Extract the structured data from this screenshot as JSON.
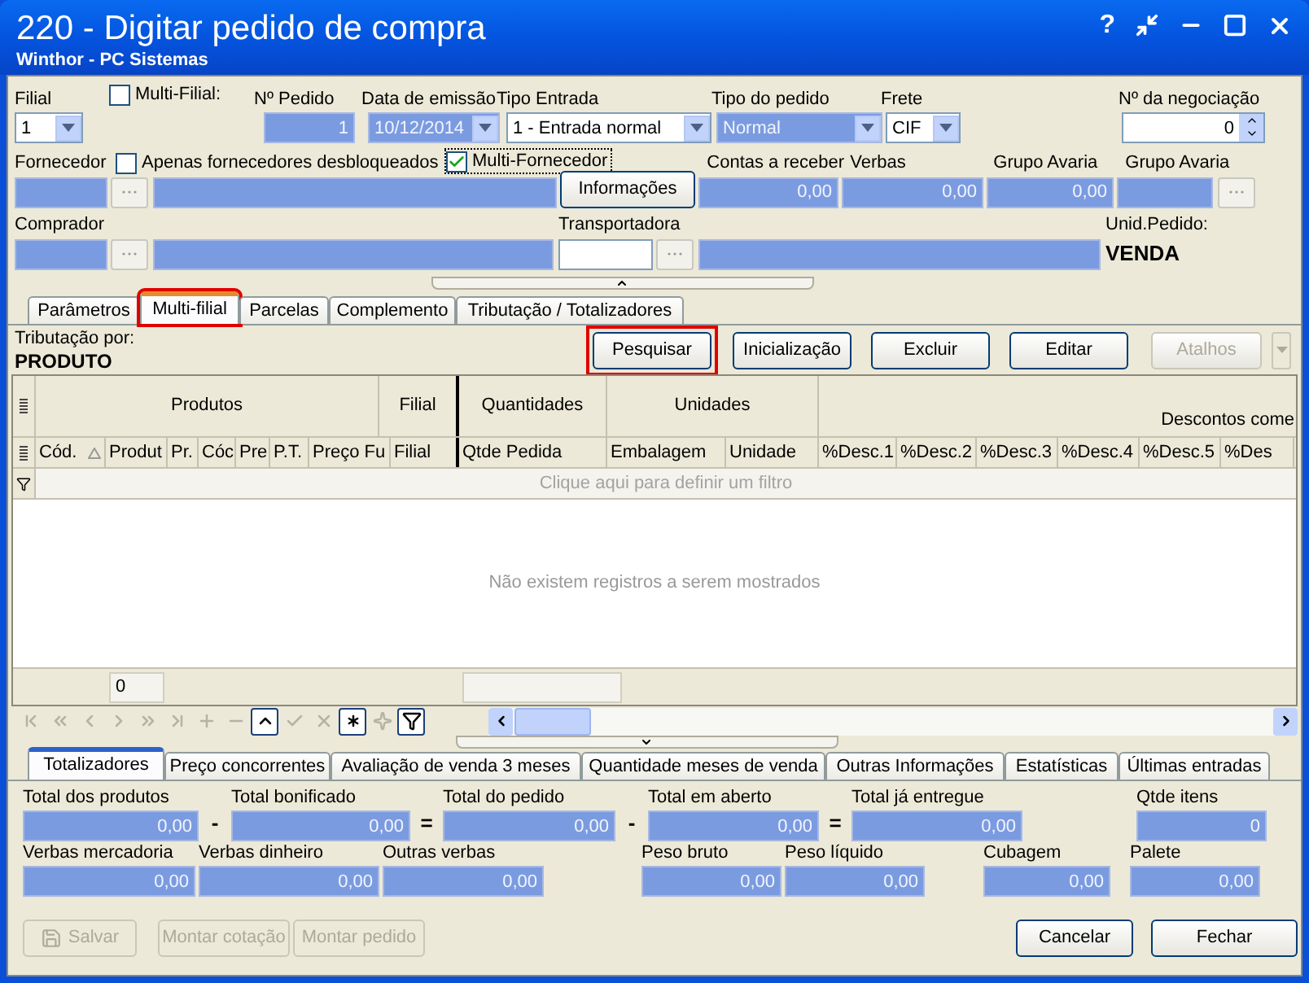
{
  "window": {
    "title": "220 - Digitar pedido de compra",
    "subtitle": "Winthor - PC Sistemas",
    "help_glyph": "?"
  },
  "header": {
    "filial": {
      "label": "Filial",
      "value": "1",
      "readonly": false
    },
    "multi_filial": {
      "label": "Multi-Filial:",
      "checked": false
    },
    "numero_pedido": {
      "label": "Nº Pedido",
      "value": "1",
      "readonly": true
    },
    "data_emissao": {
      "label": "Data de emissão",
      "value": "10/12/2014",
      "readonly": true
    },
    "tipo_entrada": {
      "label": "Tipo Entrada",
      "value": "1 - Entrada normal",
      "readonly": false
    },
    "tipo_pedido": {
      "label": "Tipo do pedido",
      "value": "Normal",
      "readonly": true
    },
    "frete": {
      "label": "Frete",
      "value": "CIF",
      "readonly": false
    },
    "negociacao": {
      "label": "Nº da negociação",
      "value": "0",
      "readonly": false
    },
    "fornecedor": {
      "label": "Fornecedor"
    },
    "apenas_desbloqueados": {
      "label": "Apenas fornecedores desbloqueados",
      "checked": false
    },
    "multi_fornecedor": {
      "label": "Multi-Fornecedor",
      "checked": true
    },
    "informacoes_button": "Informações",
    "contas_receber": {
      "label": "Contas a receber",
      "value": "0,00"
    },
    "verbas": {
      "label": "Verbas",
      "value": "0,00"
    },
    "grupo_avaria": {
      "label": "Grupo Avaria",
      "value": "0,00"
    },
    "grupo_avaria_2": {
      "label": "Grupo Avaria"
    },
    "comprador": {
      "label": "Comprador"
    },
    "transportadora": {
      "label": "Transportadora"
    },
    "unid_pedido": {
      "label": "Unid.Pedido:",
      "value": "VENDA"
    }
  },
  "tabs": [
    {
      "label": "Parâmetros",
      "selected": false,
      "highlighted": false
    },
    {
      "label": "Multi-filial",
      "selected": true,
      "highlighted": true
    },
    {
      "label": "Parcelas",
      "selected": false,
      "highlighted": false
    },
    {
      "label": "Complemento",
      "selected": false,
      "highlighted": false
    },
    {
      "label": "Tributação / Totalizadores",
      "selected": false,
      "highlighted": false
    }
  ],
  "tributacao": {
    "label": "Tributação por:",
    "value": "PRODUTO"
  },
  "actions": [
    {
      "label": "Pesquisar",
      "highlighted": true,
      "disabled": false
    },
    {
      "label": "Inicialização",
      "highlighted": false,
      "disabled": false
    },
    {
      "label": "Excluir",
      "highlighted": false,
      "disabled": false
    },
    {
      "label": "Editar",
      "highlighted": false,
      "disabled": false
    },
    {
      "label": "Atalhos",
      "highlighted": false,
      "disabled": true
    }
  ],
  "grid": {
    "bands": [
      "Produtos",
      "Filial",
      "Quantidades",
      "Unidades",
      "Descontos come"
    ],
    "columns": [
      {
        "label": "Cód.",
        "sorted": true
      },
      {
        "label": "Produt",
        "sorted": false
      },
      {
        "label": "Pr.",
        "sorted": false
      },
      {
        "label": "Cóc",
        "sorted": false
      },
      {
        "label": "Pre",
        "sorted": false
      },
      {
        "label": "P.T.",
        "sorted": false
      },
      {
        "label": "Preço Fu",
        "sorted": false
      },
      {
        "label": "Filial",
        "sorted": false
      },
      {
        "label": "Qtde Pedida",
        "sorted": false
      },
      {
        "label": "Embalagem",
        "sorted": false
      },
      {
        "label": "Unidade",
        "sorted": false
      },
      {
        "label": "%Desc.1",
        "sorted": false
      },
      {
        "label": "%Desc.2",
        "sorted": false
      },
      {
        "label": "%Desc.3",
        "sorted": false
      },
      {
        "label": "%Desc.4",
        "sorted": false
      },
      {
        "label": "%Desc.5",
        "sorted": false
      },
      {
        "label": "%Des",
        "sorted": false
      }
    ],
    "filter_hint": "Clique aqui para definir um filtro",
    "empty_message": "Não existem registros a serem mostrados",
    "footer_count": "0"
  },
  "bottom_tabs": [
    {
      "label": "Totalizadores",
      "selected": true
    },
    {
      "label": "Preço concorrentes",
      "selected": false
    },
    {
      "label": "Avaliação de venda 3 meses",
      "selected": false
    },
    {
      "label": "Quantidade meses de venda",
      "selected": false
    },
    {
      "label": "Outras Informações",
      "selected": false
    },
    {
      "label": "Estatísticas",
      "selected": false
    },
    {
      "label": "Últimas entradas",
      "selected": false
    }
  ],
  "totals": [
    {
      "label": "Total dos produtos",
      "value": "0,00",
      "operator": "-"
    },
    {
      "label": "Total bonificado",
      "value": "0,00",
      "operator": "="
    },
    {
      "label": "Total do pedido",
      "value": "0,00",
      "operator": "-"
    },
    {
      "label": "Total  em aberto",
      "value": "0,00",
      "operator": "="
    },
    {
      "label": "Total já entregue",
      "value": "0,00"
    },
    {
      "label": "Qtde itens",
      "value": "0"
    }
  ],
  "totals_2": [
    {
      "label": "Verbas mercadoria",
      "value": "0,00"
    },
    {
      "label": "Verbas dinheiro",
      "value": "0,00"
    },
    {
      "label": "Outras verbas",
      "value": "0,00"
    },
    {
      "label": "Peso bruto",
      "value": "0,00"
    },
    {
      "label": "Peso líquido",
      "value": "0,00"
    },
    {
      "label": "Cubagem",
      "value": "0,00"
    },
    {
      "label": "Palete",
      "value": "0,00"
    }
  ],
  "footer_buttons": [
    {
      "label": "Salvar",
      "disabled": true,
      "kind": "save"
    },
    {
      "label": "Montar cotação",
      "disabled": true,
      "kind": "plain"
    },
    {
      "label": "Montar pedido",
      "disabled": true,
      "kind": "plain"
    },
    {
      "label": "Cancelar",
      "disabled": false,
      "kind": "plain"
    },
    {
      "label": "Fechar",
      "disabled": false,
      "kind": "plain"
    }
  ]
}
